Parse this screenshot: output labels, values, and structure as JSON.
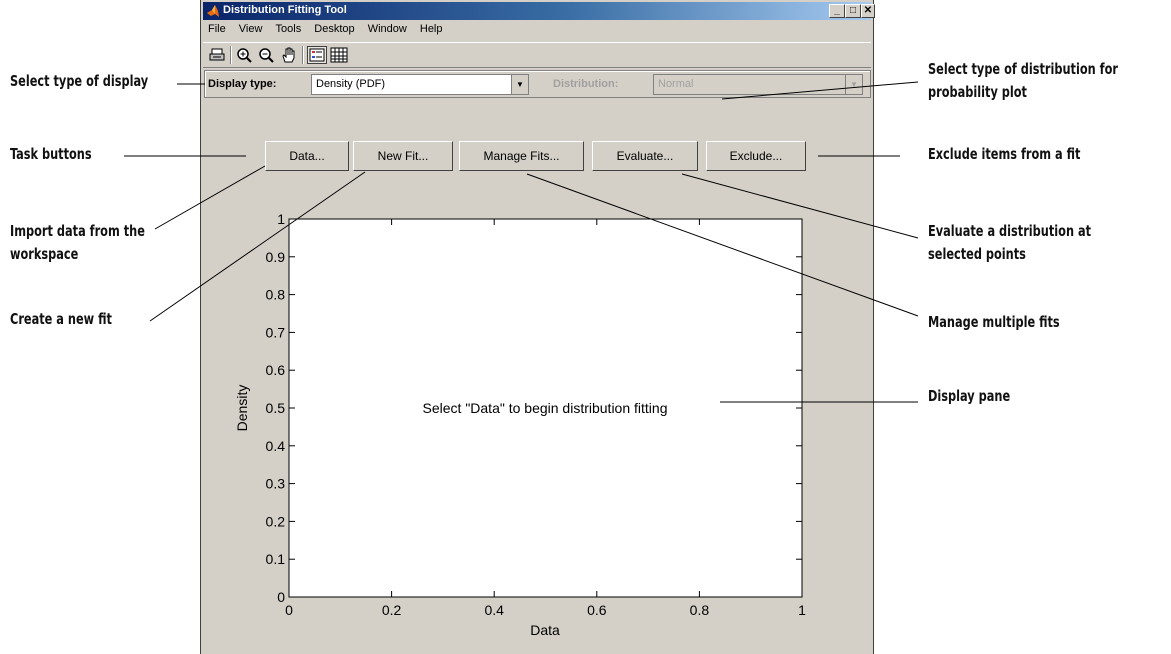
{
  "window": {
    "title": "Distribution Fitting Tool",
    "caption_buttons": [
      "_",
      "□",
      "✕"
    ]
  },
  "menu": [
    "File",
    "View",
    "Tools",
    "Desktop",
    "Window",
    "Help"
  ],
  "toolbar_icons": [
    "print-icon",
    "zoom-in-icon",
    "zoom-out-icon",
    "pan-hand-icon",
    "legend-toggle-icon",
    "grid-toggle-icon"
  ],
  "display": {
    "type_label": "Display type:",
    "type_value": "Density (PDF)",
    "dist_label": "Distribution:",
    "dist_value": "Normal"
  },
  "buttons": [
    "Data...",
    "New Fit...",
    "Manage Fits...",
    "Evaluate...",
    "Exclude..."
  ],
  "plot": {
    "message": "Select \"Data\" to begin distribution fitting",
    "xlabel": "Data",
    "ylabel": "Density",
    "xlim": [
      0,
      1
    ],
    "ylim": [
      0,
      1
    ],
    "xticks": [
      "0",
      "0.2",
      "0.4",
      "0.6",
      "0.8",
      "1"
    ],
    "yticks": [
      "0",
      "0.1",
      "0.2",
      "0.3",
      "0.4",
      "0.5",
      "0.6",
      "0.7",
      "0.8",
      "0.9",
      "1"
    ]
  },
  "callouts": {
    "select_display": "Select type of display",
    "task_buttons": "Task buttons",
    "import_data_1": "Import data from the",
    "import_data_2": "workspace",
    "create_fit": "Create a new fit",
    "select_dist_1": "Select type of distribution for",
    "select_dist_2": "probability plot",
    "exclude": "Exclude items from a fit",
    "evaluate_1": "Evaluate a distribution at",
    "evaluate_2": "selected points",
    "manage": "Manage multiple fits",
    "display_pane": "Display pane"
  },
  "colors": {
    "window_bg": "#d4d0c8",
    "title_start": "#0a246a",
    "title_end": "#a6caf0"
  }
}
